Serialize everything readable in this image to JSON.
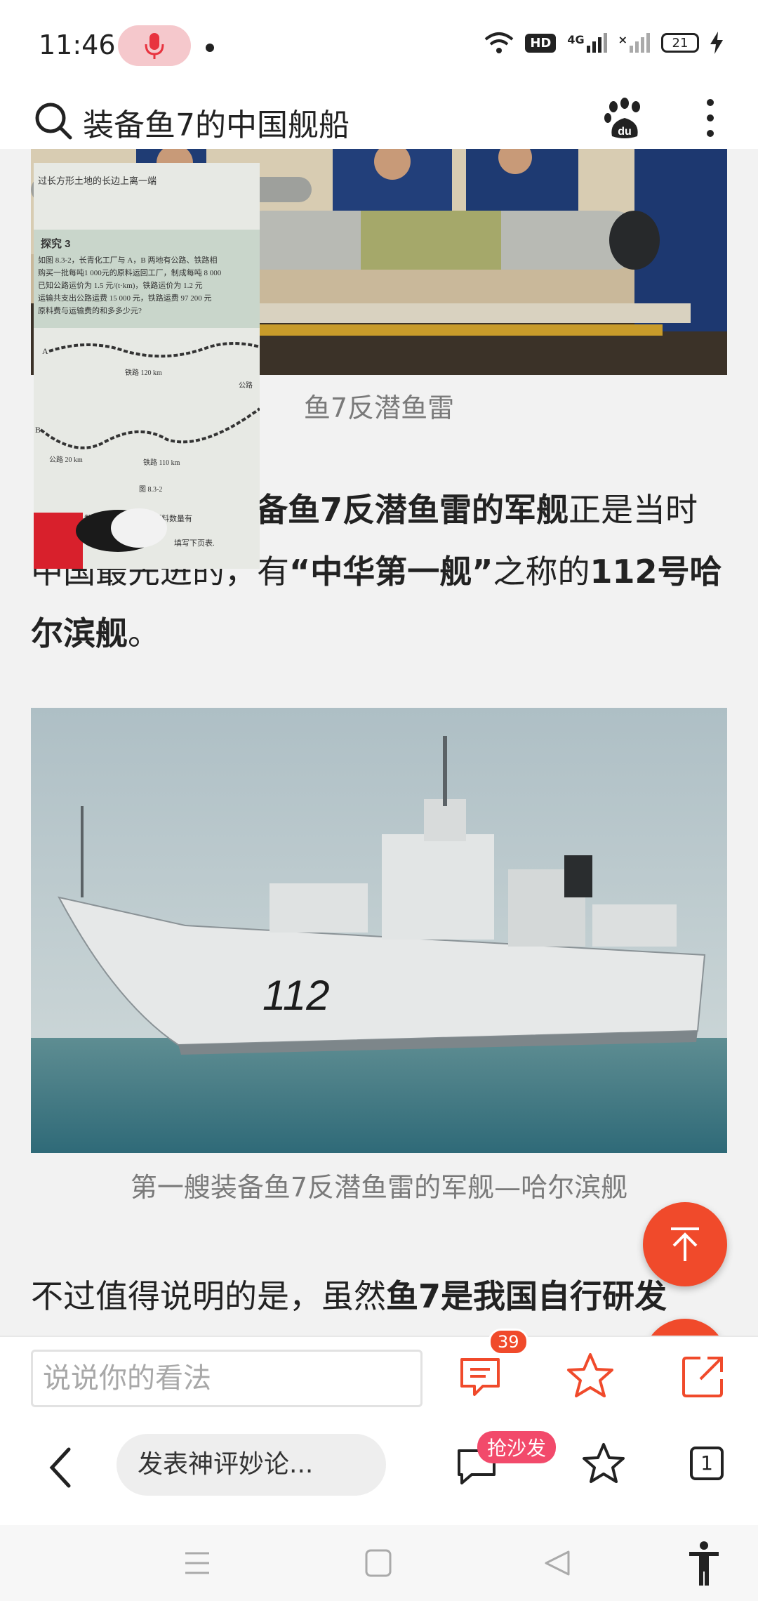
{
  "status": {
    "time": "11:46",
    "hd": "HD",
    "network": "4G",
    "battery": "21"
  },
  "search": {
    "query": "装备鱼7的中国舰船"
  },
  "article": {
    "caption1": "鱼7反潜鱼雷",
    "para1": {
      "p1": "备鱼7反潜鱼雷的军舰",
      "p2": "正是当时中国最先进的，有",
      "p3": "“中华第一舰”",
      "p4": "之称的",
      "p5": "112号哈尔滨舰",
      "p6": "。"
    },
    "caption2": "第一艘装备鱼7反潜鱼雷的军舰—哈尔滨舰",
    "para2": {
      "p1": "不过值得说明的是，虽然",
      "p2": "鱼7是我国自行研发"
    },
    "hull_number": "112"
  },
  "overlay": {
    "section_title": "探究 3",
    "line1": "过长方形土地的长边上离一端",
    "line2": "如图 8.3-2，长青化工厂与 A，B 两地有公路、铁路相",
    "line3": "购买一批每吨1 000元的原料运回工厂，制成每吨 8 000",
    "line4": "已知公路运价为 1.5 元/(t·km)，铁路运价为 1.2 元",
    "line5": "运输共支出公路运费 15 000 元，铁路运费 97 200 元",
    "line6": "原料费与运输费的和多多少元?",
    "label_a": "A",
    "label_rail120": "铁路 120 km",
    "label_road": "公路",
    "label_b": "B",
    "label_road20": "公路 20 km",
    "label_rail110": "铁路 110 km",
    "fig": "图 8.3-2",
    "line7": "销售款与产品数量有关，原料费与原料数量有",
    "line8": "填写下页表."
  },
  "comment_bar": {
    "placeholder": "说说你的看法",
    "comment_count": "39"
  },
  "browser_bar": {
    "post_label": "发表神评妙论...",
    "sofa_badge": "抢沙发",
    "tab_count": "1"
  },
  "colors": {
    "accent": "#f04a2b",
    "badge_pink": "#f24a6b"
  }
}
